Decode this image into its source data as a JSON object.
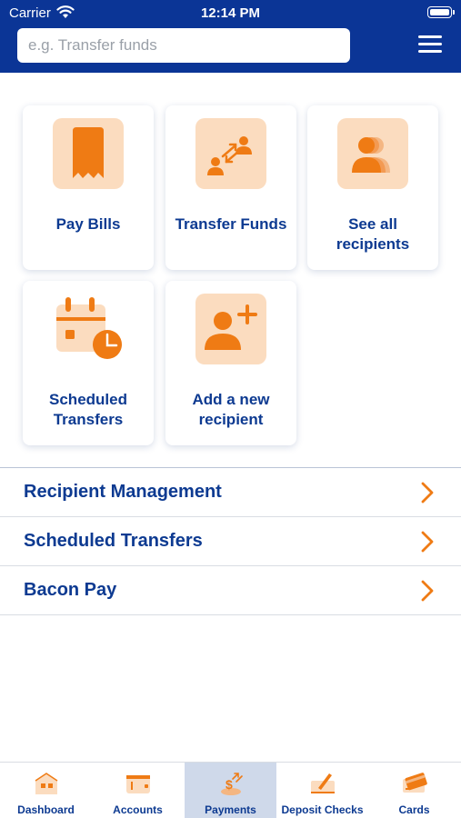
{
  "status_bar": {
    "carrier": "Carrier",
    "time": "12:14 PM"
  },
  "search": {
    "placeholder": "e.g. Transfer funds",
    "value": ""
  },
  "tiles": [
    {
      "label": "Pay Bills",
      "icon": "receipt-icon"
    },
    {
      "label": "Transfer Funds",
      "icon": "transfer-people-icon"
    },
    {
      "label": "See all recipients",
      "icon": "recipients-group-icon"
    },
    {
      "label": "Scheduled Transfers",
      "icon": "calendar-clock-icon"
    },
    {
      "label": "Add a new recipient",
      "icon": "add-person-icon"
    }
  ],
  "list": [
    {
      "label": "Recipient Management"
    },
    {
      "label": "Scheduled Transfers"
    },
    {
      "label": "Bacon Pay"
    }
  ],
  "tabs": [
    {
      "label": "Dashboard",
      "icon": "house-icon",
      "active": false
    },
    {
      "label": "Accounts",
      "icon": "wallet-icon",
      "active": false
    },
    {
      "label": "Payments",
      "icon": "payments-icon",
      "active": true
    },
    {
      "label": "Deposit Checks",
      "icon": "check-deposit-icon",
      "active": false
    },
    {
      "label": "Cards",
      "icon": "cards-icon",
      "active": false
    }
  ],
  "colors": {
    "brand_blue": "#0b3596",
    "text_blue": "#0d3a91",
    "accent_orange": "#ef7b14",
    "icon_bg": "#fbdcbf",
    "active_tab_bg": "#cfd9ea"
  }
}
